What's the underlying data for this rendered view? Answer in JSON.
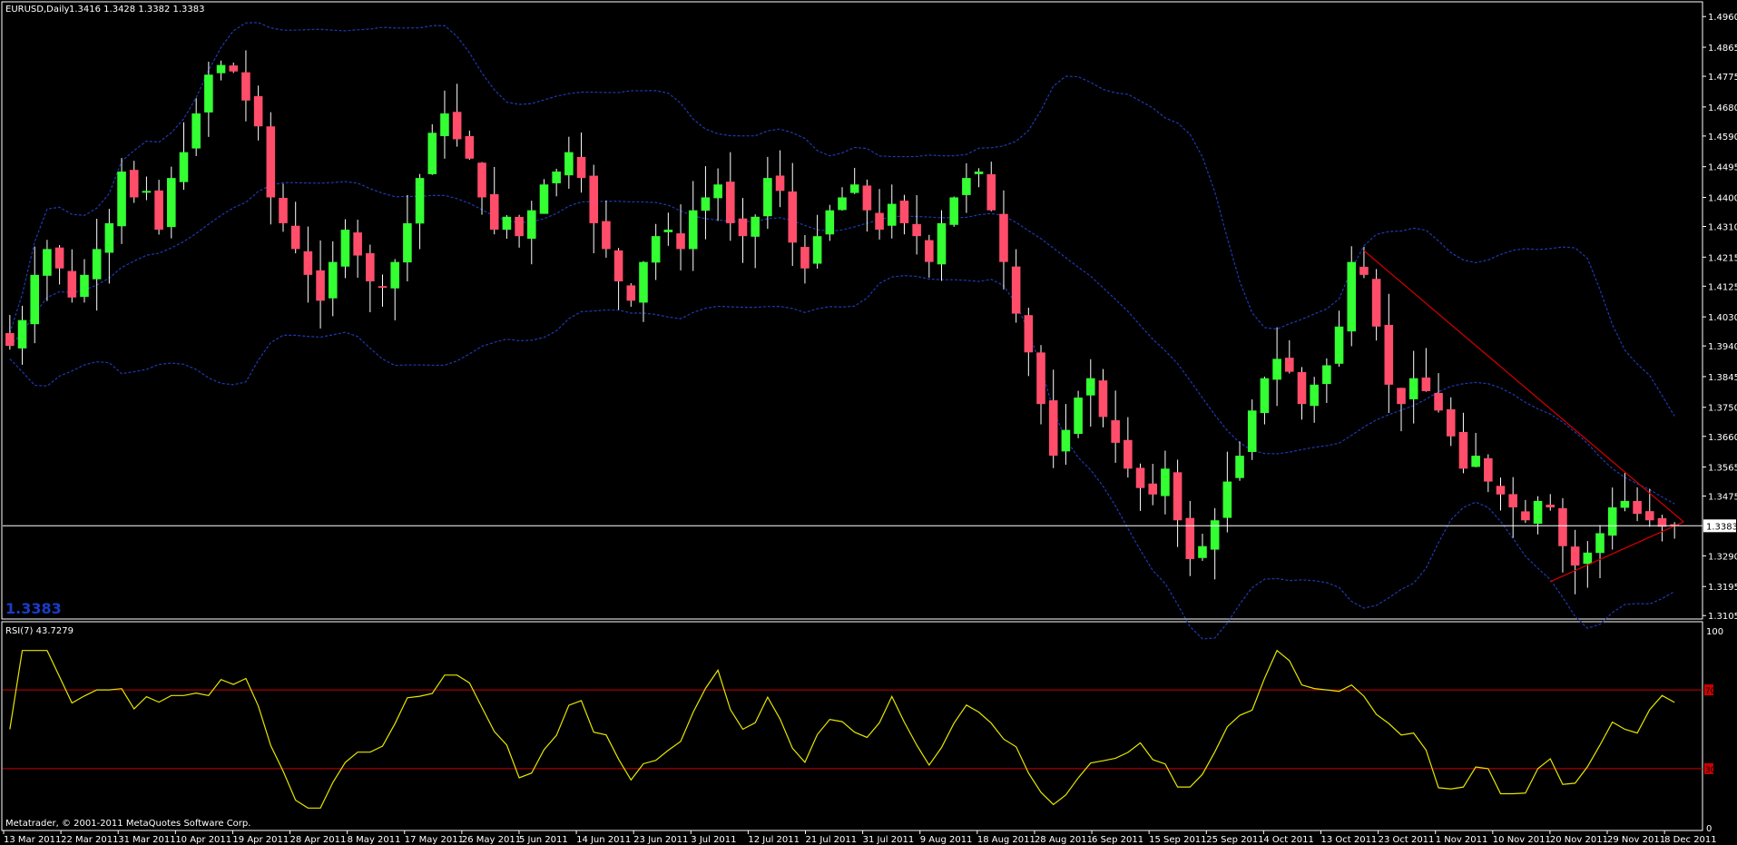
{
  "window": {
    "symbol_title": "EURUSD,Daily",
    "ohlc_header": "1.3416 1.3428 1.3382 1.3383",
    "big_price": "1.3383",
    "copyright": "Metatrader, © 2001-2011 MetaQuotes Software Corp."
  },
  "colors": {
    "background": "#000000",
    "grid_frame": "#ffffff",
    "bull_candle": "#33ff33",
    "bear_candle": "#ff4d6a",
    "bollinger": "#1e3ab0",
    "rsi_line": "#e6e600",
    "level_line": "#cc0000",
    "trendline": "#cc0000",
    "big_price_color": "#1a3cc8"
  },
  "chart_data": [
    {
      "type": "candlestick",
      "title": "EURUSD,Daily",
      "ylim": [
        1.31,
        1.5
      ],
      "y_ticks": [
        "1.4960",
        "1.4865",
        "1.4775",
        "1.4680",
        "1.4590",
        "1.4495",
        "1.4400",
        "1.4310",
        "1.4215",
        "1.4125",
        "1.4030",
        "1.3940",
        "1.3845",
        "1.3750",
        "1.3660",
        "1.3565",
        "1.3475",
        "1.3383",
        "1.3290",
        "1.3195",
        "1.3105"
      ],
      "current_price": 1.3383,
      "x_ticks": [
        "13 Mar 2011",
        "22 Mar 2011",
        "31 Mar 2011",
        "10 Apr 2011",
        "19 Apr 2011",
        "28 Apr 2011",
        "8 May 2011",
        "17 May 2011",
        "26 May 2011",
        "5 Jun 2011",
        "14 Jun 2011",
        "23 Jun 2011",
        "3 Jul 2011",
        "12 Jul 2011",
        "21 Jul 2011",
        "31 Jul 2011",
        "9 Aug 2011",
        "18 Aug 2011",
        "28 Aug 2011",
        "6 Sep 2011",
        "15 Sep 2011",
        "25 Sep 2011",
        "4 Oct 2011",
        "13 Oct 2011",
        "23 Oct 2011",
        "1 Nov 2011",
        "10 Nov 2011",
        "20 Nov 2011",
        "29 Nov 2011",
        "8 Dec 2011"
      ],
      "close_path": [
        1.394,
        1.402,
        1.416,
        1.424,
        1.418,
        1.409,
        1.416,
        1.424,
        1.432,
        1.448,
        1.44,
        1.442,
        1.43,
        1.446,
        1.454,
        1.466,
        1.478,
        1.481,
        1.479,
        1.47,
        1.462,
        1.44,
        1.432,
        1.424,
        1.416,
        1.408,
        1.42,
        1.43,
        1.422,
        1.414,
        1.412,
        1.42,
        1.432,
        1.446,
        1.46,
        1.466,
        1.458,
        1.452,
        1.44,
        1.43,
        1.434,
        1.428,
        1.436,
        1.444,
        1.448,
        1.454,
        1.446,
        1.432,
        1.424,
        1.414,
        1.408,
        1.42,
        1.428,
        1.43,
        1.424,
        1.436,
        1.44,
        1.444,
        1.432,
        1.428,
        1.434,
        1.446,
        1.442,
        1.426,
        1.418,
        1.428,
        1.436,
        1.44,
        1.444,
        1.436,
        1.43,
        1.438,
        1.432,
        1.428,
        1.42,
        1.432,
        1.44,
        1.446,
        1.448,
        1.436,
        1.42,
        1.404,
        1.392,
        1.376,
        1.36,
        1.368,
        1.378,
        1.384,
        1.372,
        1.364,
        1.356,
        1.35,
        1.348,
        1.356,
        1.34,
        1.328,
        1.332,
        1.34,
        1.352,
        1.36,
        1.374,
        1.384,
        1.39,
        1.386,
        1.376,
        1.382,
        1.388,
        1.4,
        1.42,
        1.416,
        1.4,
        1.382,
        1.376,
        1.384,
        1.38,
        1.374,
        1.366,
        1.356,
        1.36,
        1.352,
        1.348,
        1.344,
        1.34,
        1.346,
        1.344,
        1.332,
        1.326,
        1.33,
        1.336,
        1.344,
        1.346,
        1.342,
        1.34,
        1.338,
        1.3383
      ],
      "bollinger": {
        "period": 20
      }
    },
    {
      "type": "line",
      "title": "RSI(7) 43.7279",
      "ylim": [
        0,
        100
      ],
      "y_ticks": [
        "100",
        "0"
      ],
      "levels": [
        70,
        30
      ],
      "level_markers": [
        "70",
        "30"
      ]
    }
  ]
}
